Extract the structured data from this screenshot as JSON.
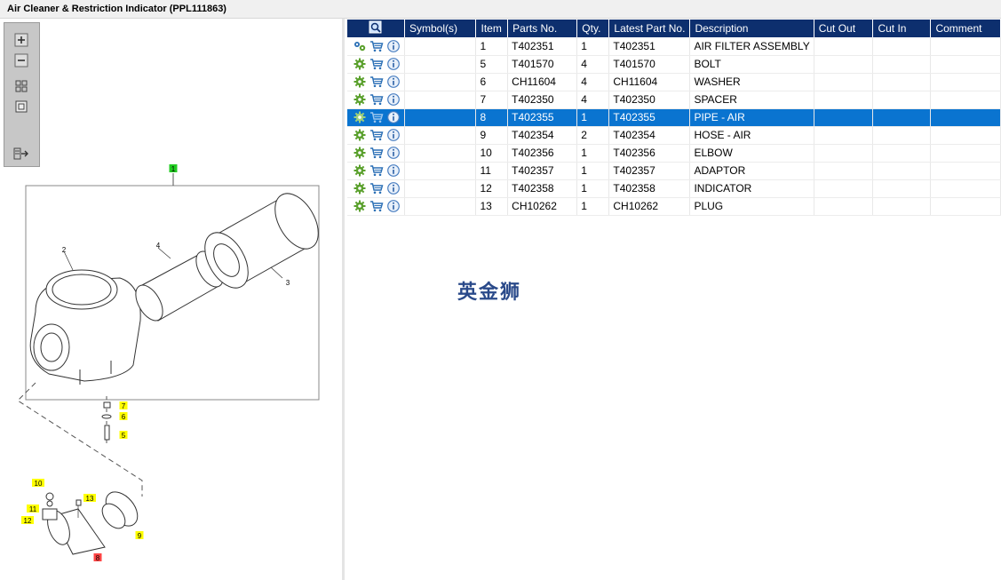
{
  "window": {
    "title": "Air Cleaner & Restriction Indicator (PPL111863)"
  },
  "toolbox": {
    "buttons": [
      {
        "name": "zoom-in-icon"
      },
      {
        "name": "zoom-out-icon"
      },
      {
        "name": "fit-all-icon"
      },
      {
        "name": "actual-size-icon"
      },
      {
        "name": "export-icon"
      }
    ]
  },
  "drawing": {
    "callouts": [
      {
        "label": "1",
        "highlight": "#22cc22"
      },
      {
        "label": "2"
      },
      {
        "label": "3"
      },
      {
        "label": "4"
      },
      {
        "label": "5",
        "highlight": "#ffff00"
      },
      {
        "label": "6",
        "highlight": "#ffff00"
      },
      {
        "label": "7",
        "highlight": "#ffff00"
      },
      {
        "label": "8",
        "highlight": "#ff4444"
      },
      {
        "label": "9",
        "highlight": "#ffff00"
      },
      {
        "label": "10",
        "highlight": "#ffff00"
      },
      {
        "label": "11",
        "highlight": "#ffff00"
      },
      {
        "label": "12",
        "highlight": "#ffff00"
      },
      {
        "label": "13",
        "highlight": "#ffff00"
      }
    ]
  },
  "table": {
    "columns": [
      "Symbol(s)",
      "Item",
      "Parts No.",
      "Qty.",
      "Latest Part No.",
      "Description",
      "Cut Out",
      "Cut In",
      "Comment"
    ],
    "rows": [
      {
        "item": "1",
        "part": "T402351",
        "qty": "1",
        "latest": "T402351",
        "desc": "AIR FILTER ASSEMBLY",
        "assembly": true
      },
      {
        "item": "5",
        "part": "T401570",
        "qty": "4",
        "latest": "T401570",
        "desc": "BOLT"
      },
      {
        "item": "6",
        "part": "CH11604",
        "qty": "4",
        "latest": "CH11604",
        "desc": "WASHER"
      },
      {
        "item": "7",
        "part": "T402350",
        "qty": "4",
        "latest": "T402350",
        "desc": "SPACER"
      },
      {
        "item": "8",
        "part": "T402355",
        "qty": "1",
        "latest": "T402355",
        "desc": "PIPE - AIR",
        "selected": true
      },
      {
        "item": "9",
        "part": "T402354",
        "qty": "2",
        "latest": "T402354",
        "desc": "HOSE - AIR"
      },
      {
        "item": "10",
        "part": "T402356",
        "qty": "1",
        "latest": "T402356",
        "desc": "ELBOW"
      },
      {
        "item": "11",
        "part": "T402357",
        "qty": "1",
        "latest": "T402357",
        "desc": "ADAPTOR"
      },
      {
        "item": "12",
        "part": "T402358",
        "qty": "1",
        "latest": "T402358",
        "desc": "INDICATOR"
      },
      {
        "item": "13",
        "part": "CH10262",
        "qty": "1",
        "latest": "CH10262",
        "desc": "PLUG"
      }
    ]
  },
  "watermark": "英金狮",
  "colors": {
    "header": "#0d2f6e",
    "selected_row": "#0a74d0",
    "gear": "#5aa02c",
    "cart": "#2a6fb5",
    "info": "#4a7fc1"
  }
}
